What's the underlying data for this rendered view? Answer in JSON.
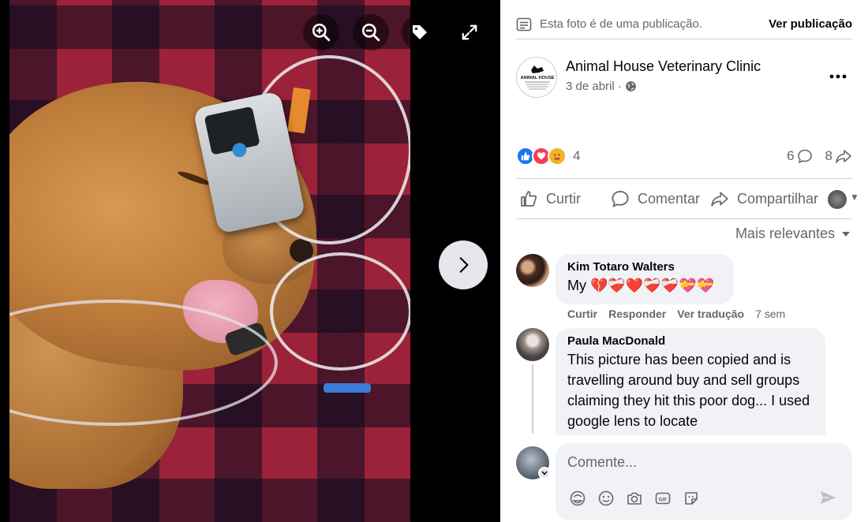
{
  "post_note": {
    "text": "Esta foto é de uma publicação.",
    "link": "Ver publicação"
  },
  "author": {
    "name": "Animal House Veterinary Clinic",
    "date": "3 de abril ·",
    "logo_text": "ANIMAL HOUSE"
  },
  "reactions": {
    "count": "4",
    "comments_count": "6",
    "shares_count": "8"
  },
  "actions": {
    "like": "Curtir",
    "comment": "Comentar",
    "share": "Compartilhar"
  },
  "sort_label": "Mais relevantes",
  "comments": [
    {
      "author": "Kim Totaro Walters",
      "text": "My 💔❤️‍🩹❤️❤️‍🩹❤️‍🩹💝💝",
      "meta_like": "Curtir",
      "meta_reply": "Responder",
      "meta_translate": "Ver tradução",
      "time": "7 sem"
    },
    {
      "author": "Paula MacDonald",
      "text": "This picture has been copied and is travelling around buy and sell groups claiming they hit this poor dog... I used google lens to locate"
    }
  ],
  "composer": {
    "placeholder": "Comente..."
  },
  "colors": {
    "like_blue": "#1877f2",
    "love_red": "#f33e58",
    "wow_yellow": "#f7b125",
    "secondary_text": "#65676b",
    "bubble_bg": "#f0f2f5"
  },
  "icons": [
    "zoom-in-icon",
    "zoom-out-icon",
    "tag-icon",
    "fullscreen-icon",
    "chevron-right-icon",
    "post-note-icon",
    "globe-icon",
    "more-icon",
    "comment-icon",
    "share-icon",
    "like-icon",
    "caret-down-icon",
    "sticker-icon",
    "emoji-icon",
    "camera-icon",
    "gif-icon",
    "avatar-sticker-icon",
    "send-icon"
  ]
}
